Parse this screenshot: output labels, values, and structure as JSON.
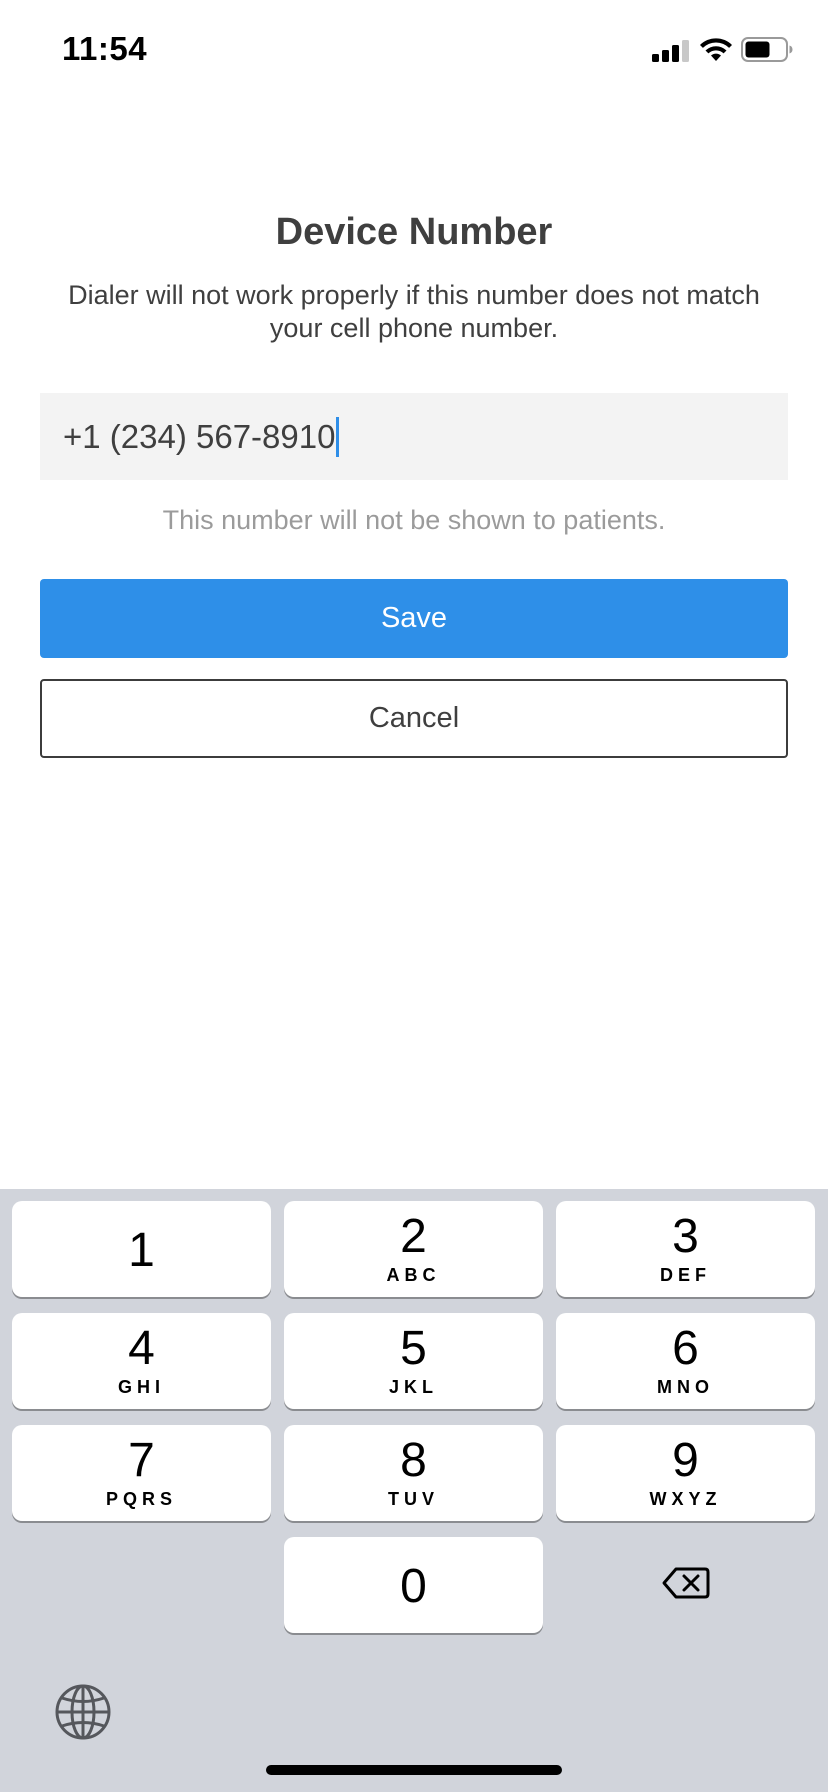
{
  "status_bar": {
    "time": "11:54",
    "icons": [
      "cellular-signal-icon",
      "wifi-icon",
      "battery-icon"
    ]
  },
  "dialog": {
    "title": "Device Number",
    "subtitle": "Dialer will not work properly if this number does not match your cell phone number.",
    "phone_field": {
      "value": "+1 (234) 567-8910",
      "focused": true
    },
    "hint": "This number will not be shown to patients.",
    "save_label": "Save",
    "cancel_label": "Cancel"
  },
  "keypad": {
    "keys": [
      {
        "digit": "1",
        "letters": ""
      },
      {
        "digit": "2",
        "letters": "ABC"
      },
      {
        "digit": "3",
        "letters": "DEF"
      },
      {
        "digit": "4",
        "letters": "GHI"
      },
      {
        "digit": "5",
        "letters": "JKL"
      },
      {
        "digit": "6",
        "letters": "MNO"
      },
      {
        "digit": "7",
        "letters": "PQRS"
      },
      {
        "digit": "8",
        "letters": "TUV"
      },
      {
        "digit": "9",
        "letters": "WXYZ"
      },
      {
        "digit": "0",
        "letters": ""
      }
    ],
    "delete_icon": "backspace-icon",
    "globe_icon": "globe-icon"
  },
  "colors": {
    "accent": "#2e8fe8",
    "keyboard_background": "#d1d4db",
    "input_background": "#f3f3f3"
  }
}
